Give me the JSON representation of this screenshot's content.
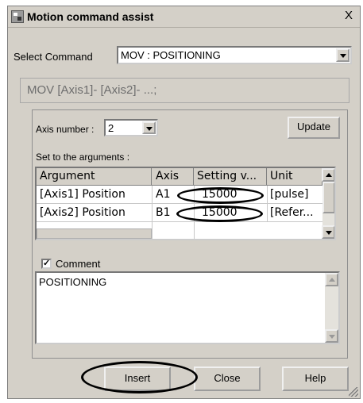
{
  "window": {
    "title": "Motion command assist",
    "close_symbol": "X"
  },
  "select_command": {
    "label": "Select Command",
    "value": "MOV : POSITIONING"
  },
  "command_syntax": "MOV [Axis1]- [Axis2]- ...;",
  "axis_number": {
    "label": "Axis number :",
    "value": "2"
  },
  "update_button": "Update",
  "arguments": {
    "label": "Set to the arguments :",
    "columns": [
      "Argument",
      "Axis",
      "Setting v...",
      "Unit"
    ],
    "rows": [
      {
        "argument": "[Axis1] Position",
        "axis": "A1",
        "setting": "15000",
        "unit": "[pulse]"
      },
      {
        "argument": "[Axis2] Position",
        "axis": "B1",
        "setting": "15000",
        "unit": "[Refer..."
      }
    ]
  },
  "comment": {
    "label": "Comment",
    "checked": true,
    "check_mark": "✓",
    "text": "POSITIONING"
  },
  "buttons": {
    "insert": "Insert",
    "close": "Close",
    "help": "Help"
  },
  "icons": [
    "app-icon",
    "close-icon",
    "dropdown-arrow-icon",
    "scroll-up-icon",
    "scroll-down-icon",
    "checkmark-icon",
    "resize-grip-icon"
  ]
}
